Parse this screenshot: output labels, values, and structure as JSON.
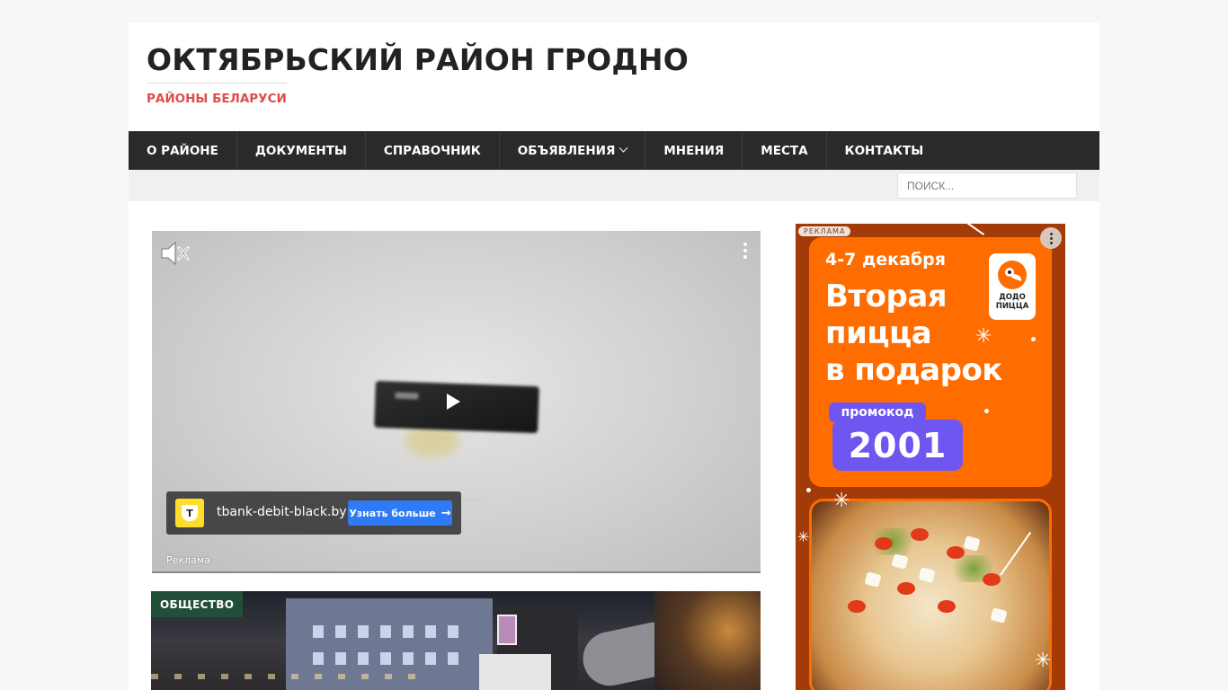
{
  "site": {
    "title": "ОКТЯБРЬСКИЙ РАЙОН ГРОДНО",
    "description": "РАЙОНЫ БЕЛАРУСИ"
  },
  "nav": {
    "items": [
      {
        "label": "О РАЙОНЕ"
      },
      {
        "label": "ДОКУМЕНТЫ"
      },
      {
        "label": "СПРАВОЧНИК"
      },
      {
        "label": "ОБЪЯВЛЕНИЯ",
        "has_dropdown": true
      },
      {
        "label": "МНЕНИЯ"
      },
      {
        "label": "МЕСТА"
      },
      {
        "label": "КОНТАКТЫ"
      }
    ]
  },
  "search": {
    "placeholder": "ПОИСК..."
  },
  "video_ad": {
    "logo_letter": "T",
    "domain": "tbank-debit-black.by",
    "button_label": "Узнать больше",
    "ad_label": "Реклама",
    "icons": [
      "mute-icon",
      "more-vertical-icon",
      "play-icon",
      "arrow-right-icon"
    ]
  },
  "article": {
    "category": "ОБЩЕСТВО"
  },
  "side_ad": {
    "tag": "РЕКЛАМА",
    "date": "4-7 декабря",
    "headline": [
      "Вторая",
      "пицца",
      "в подарок"
    ],
    "brand": [
      "ДОДО",
      "ПИЦЦА"
    ],
    "promo_label": "промокод",
    "promo_code": "2001"
  },
  "colors": {
    "accent": "#e04b4a",
    "nav_bg": "#2a2a2a",
    "category_badge": "#214f3a",
    "ad_button": "#2f7bf5",
    "promo_orange": "#ff6d01",
    "promo_purple": "#6e56f0",
    "side_ad_bg": "#a23b07"
  }
}
